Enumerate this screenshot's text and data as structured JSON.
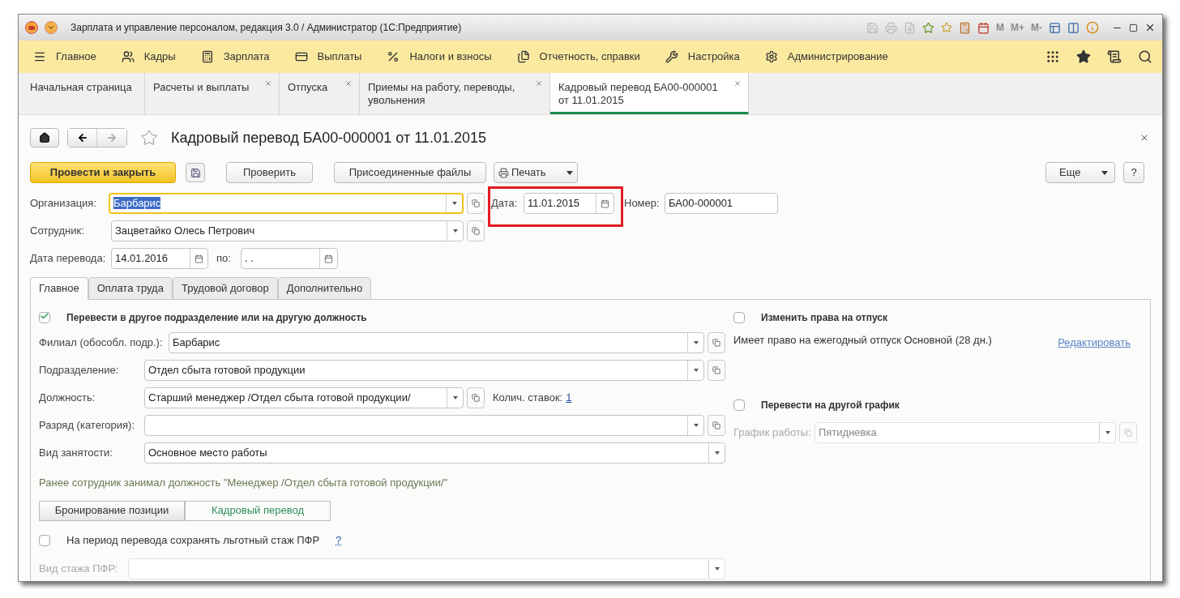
{
  "window": {
    "title": "Зарплата и управление персоналом, редакция 3.0 / Администратор  (1С:Предприятие)",
    "memory_buttons": [
      "M",
      "M+",
      "M-"
    ]
  },
  "sections": [
    {
      "label": "Главное"
    },
    {
      "label": "Кадры"
    },
    {
      "label": "Зарплата"
    },
    {
      "label": "Выплаты"
    },
    {
      "label": "Налоги и взносы"
    },
    {
      "label": "Отчетность, справки"
    },
    {
      "label": "Настройка"
    },
    {
      "label": "Администрирование"
    }
  ],
  "open_tabs": [
    {
      "label": "Начальная страница",
      "closable": false,
      "selected": false
    },
    {
      "label": "Расчеты и выплаты",
      "closable": true,
      "selected": false
    },
    {
      "label": "Отпуска",
      "closable": true,
      "selected": false
    },
    {
      "label": "Приемы на работу, переводы, увольнения",
      "closable": true,
      "selected": false
    },
    {
      "label": "Кадровый перевод БА00-000001 от 11.01.2015",
      "closable": true,
      "selected": true
    }
  ],
  "document": {
    "title": "Кадровый перевод БА00-000001 от 11.01.2015",
    "commands": {
      "post": "Провести и закрыть",
      "check": "Проверить",
      "files": "Присоединенные файлы",
      "print": "Печать",
      "more": "Еще",
      "help": "?"
    },
    "organization": {
      "label": "Организация:",
      "value": "Барбарис",
      "focused": true,
      "value_selected": true
    },
    "date": {
      "label": "Дата:",
      "value": "11.01.2015",
      "highlighted": true
    },
    "number": {
      "label": "Номер:",
      "value": "БА00-000001"
    },
    "employee": {
      "label": "Сотрудник:",
      "value": "Зацветайко Олесь Петрович"
    },
    "transfer_date": {
      "label": "Дата перевода:",
      "value": "14.01.2016"
    },
    "until": {
      "label": "по:",
      "value": ".  ."
    }
  },
  "form_tabs": [
    {
      "label": "Главное",
      "selected": true
    },
    {
      "label": "Оплата труда",
      "selected": false
    },
    {
      "label": "Трудовой договор",
      "selected": false
    },
    {
      "label": "Дополнительно",
      "selected": false
    }
  ],
  "main_tab": {
    "move_checkbox": {
      "label": "Перевести в другое подразделение или на другую должность",
      "checked": true
    },
    "fields": [
      {
        "kind": "combo",
        "label": "Филиал (обособл. подр.):",
        "value": "Барбарис"
      },
      {
        "kind": "combo",
        "label": "Подразделение:",
        "value": "Отдел сбыта готовой продукции"
      },
      {
        "kind": "position",
        "label": "Должность:",
        "value": "Старший менеджер /Отдел сбыта готовой продукции/",
        "rate_label": "Колич. ставок:",
        "rate": "1"
      },
      {
        "kind": "combo",
        "label": "Разряд (категория):"
      },
      {
        "kind": "select",
        "label": "Вид занятости:",
        "value": "Основное место работы"
      }
    ],
    "previous_note": "Ранее сотрудник занимал должность \"Менеджер /Отдел сбыта готовой продукции/\"",
    "mode_buttons": [
      {
        "label": "Бронирование позиции",
        "selected": false
      },
      {
        "label": "Кадровый перевод",
        "selected": true
      }
    ],
    "pfr_checkbox": {
      "label": "На период перевода сохранять льготный стаж ПФР",
      "checked": false,
      "help": "?"
    },
    "pfr_field": {
      "label": "Вид стажа ПФР:",
      "disabled": true
    },
    "vacation_checkbox": {
      "label": "Изменить права на отпуск",
      "checked": false
    },
    "vacation_note": "Имеет право на ежегодный отпуск Основной (28 дн.)",
    "edit_link": "Редактировать",
    "schedule_checkbox": {
      "label": "Перевести на другой график",
      "checked": false
    },
    "schedule_field": {
      "label": "График работы:",
      "value": "Пятидневка",
      "disabled": true
    }
  }
}
